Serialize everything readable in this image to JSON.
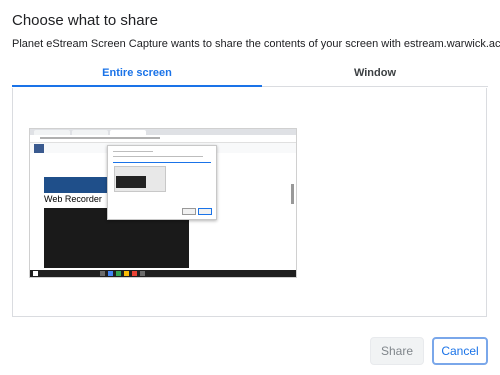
{
  "dialog": {
    "title": "Choose what to share",
    "description": "Planet eStream Screen Capture wants to share the contents of your screen with estream.warwick.ac.uk."
  },
  "tabs": [
    {
      "label": "Entire screen",
      "active": true
    },
    {
      "label": "Window",
      "active": false
    }
  ],
  "thumbnail": {
    "page_heading": "Web Recorder"
  },
  "buttons": {
    "share_label": "Share",
    "cancel_label": "Cancel"
  },
  "colors": {
    "accent": "#1a73e8",
    "text": "#202124",
    "border": "#dadce0"
  }
}
